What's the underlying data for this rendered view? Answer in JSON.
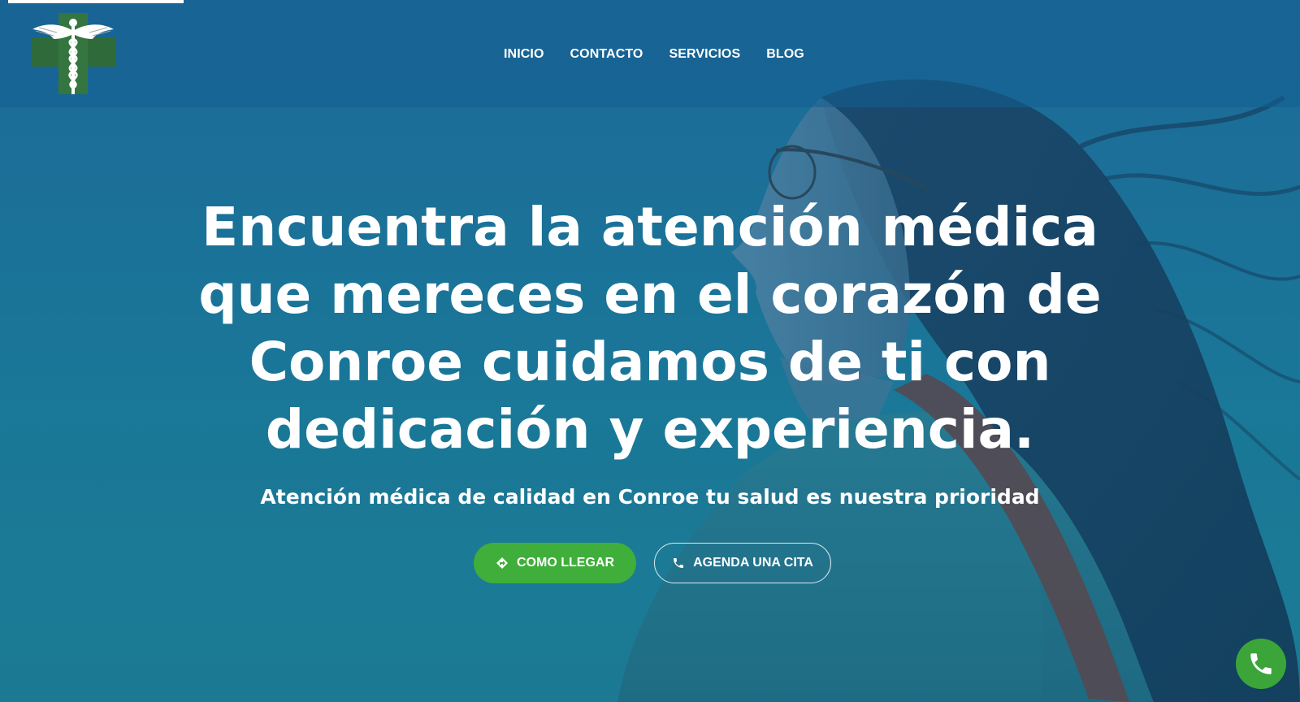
{
  "header": {
    "logo_icon": "caduceus-cross-icon",
    "nav": {
      "inicio": "INICIO",
      "contacto": "CONTACTO",
      "servicios": "SERVICIOS",
      "blog": "BLOG"
    }
  },
  "hero": {
    "headline": "Encuentra la atención médica que mereces en el corazón de Conroe cuidamos de ti con dedicación y experiencia.",
    "subheadline": "Atención médica de calidad en Conroe tu salud es nuestra prioridad",
    "buttons": {
      "directions_label": "COMO LLEGAR",
      "directions_icon": "directions-diamond-icon",
      "appointment_label": "AGENDA UNA CITA",
      "appointment_icon": "phone-icon"
    }
  },
  "floating": {
    "call_icon": "phone-icon"
  },
  "colors": {
    "primary_green": "#3fae3a",
    "hero_blue": "#1c6b9a",
    "text": "#ffffff"
  }
}
